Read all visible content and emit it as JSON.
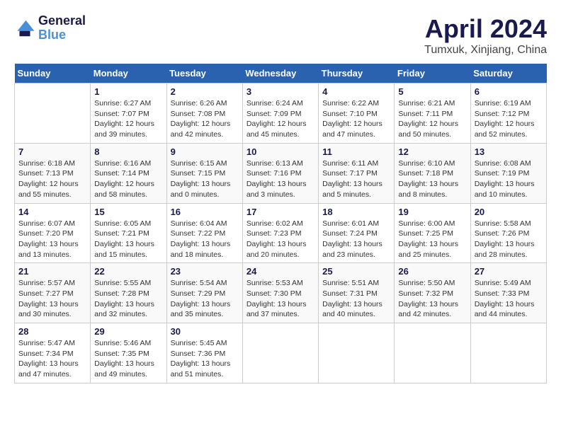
{
  "header": {
    "logo_line1": "General",
    "logo_line2": "Blue",
    "title": "April 2024",
    "subtitle": "Tumxuk, Xinjiang, China"
  },
  "weekdays": [
    "Sunday",
    "Monday",
    "Tuesday",
    "Wednesday",
    "Thursday",
    "Friday",
    "Saturday"
  ],
  "weeks": [
    [
      {
        "day": "",
        "sunrise": "",
        "sunset": "",
        "daylight": ""
      },
      {
        "day": "1",
        "sunrise": "Sunrise: 6:27 AM",
        "sunset": "Sunset: 7:07 PM",
        "daylight": "Daylight: 12 hours and 39 minutes."
      },
      {
        "day": "2",
        "sunrise": "Sunrise: 6:26 AM",
        "sunset": "Sunset: 7:08 PM",
        "daylight": "Daylight: 12 hours and 42 minutes."
      },
      {
        "day": "3",
        "sunrise": "Sunrise: 6:24 AM",
        "sunset": "Sunset: 7:09 PM",
        "daylight": "Daylight: 12 hours and 45 minutes."
      },
      {
        "day": "4",
        "sunrise": "Sunrise: 6:22 AM",
        "sunset": "Sunset: 7:10 PM",
        "daylight": "Daylight: 12 hours and 47 minutes."
      },
      {
        "day": "5",
        "sunrise": "Sunrise: 6:21 AM",
        "sunset": "Sunset: 7:11 PM",
        "daylight": "Daylight: 12 hours and 50 minutes."
      },
      {
        "day": "6",
        "sunrise": "Sunrise: 6:19 AM",
        "sunset": "Sunset: 7:12 PM",
        "daylight": "Daylight: 12 hours and 52 minutes."
      }
    ],
    [
      {
        "day": "7",
        "sunrise": "Sunrise: 6:18 AM",
        "sunset": "Sunset: 7:13 PM",
        "daylight": "Daylight: 12 hours and 55 minutes."
      },
      {
        "day": "8",
        "sunrise": "Sunrise: 6:16 AM",
        "sunset": "Sunset: 7:14 PM",
        "daylight": "Daylight: 12 hours and 58 minutes."
      },
      {
        "day": "9",
        "sunrise": "Sunrise: 6:15 AM",
        "sunset": "Sunset: 7:15 PM",
        "daylight": "Daylight: 13 hours and 0 minutes."
      },
      {
        "day": "10",
        "sunrise": "Sunrise: 6:13 AM",
        "sunset": "Sunset: 7:16 PM",
        "daylight": "Daylight: 13 hours and 3 minutes."
      },
      {
        "day": "11",
        "sunrise": "Sunrise: 6:11 AM",
        "sunset": "Sunset: 7:17 PM",
        "daylight": "Daylight: 13 hours and 5 minutes."
      },
      {
        "day": "12",
        "sunrise": "Sunrise: 6:10 AM",
        "sunset": "Sunset: 7:18 PM",
        "daylight": "Daylight: 13 hours and 8 minutes."
      },
      {
        "day": "13",
        "sunrise": "Sunrise: 6:08 AM",
        "sunset": "Sunset: 7:19 PM",
        "daylight": "Daylight: 13 hours and 10 minutes."
      }
    ],
    [
      {
        "day": "14",
        "sunrise": "Sunrise: 6:07 AM",
        "sunset": "Sunset: 7:20 PM",
        "daylight": "Daylight: 13 hours and 13 minutes."
      },
      {
        "day": "15",
        "sunrise": "Sunrise: 6:05 AM",
        "sunset": "Sunset: 7:21 PM",
        "daylight": "Daylight: 13 hours and 15 minutes."
      },
      {
        "day": "16",
        "sunrise": "Sunrise: 6:04 AM",
        "sunset": "Sunset: 7:22 PM",
        "daylight": "Daylight: 13 hours and 18 minutes."
      },
      {
        "day": "17",
        "sunrise": "Sunrise: 6:02 AM",
        "sunset": "Sunset: 7:23 PM",
        "daylight": "Daylight: 13 hours and 20 minutes."
      },
      {
        "day": "18",
        "sunrise": "Sunrise: 6:01 AM",
        "sunset": "Sunset: 7:24 PM",
        "daylight": "Daylight: 13 hours and 23 minutes."
      },
      {
        "day": "19",
        "sunrise": "Sunrise: 6:00 AM",
        "sunset": "Sunset: 7:25 PM",
        "daylight": "Daylight: 13 hours and 25 minutes."
      },
      {
        "day": "20",
        "sunrise": "Sunrise: 5:58 AM",
        "sunset": "Sunset: 7:26 PM",
        "daylight": "Daylight: 13 hours and 28 minutes."
      }
    ],
    [
      {
        "day": "21",
        "sunrise": "Sunrise: 5:57 AM",
        "sunset": "Sunset: 7:27 PM",
        "daylight": "Daylight: 13 hours and 30 minutes."
      },
      {
        "day": "22",
        "sunrise": "Sunrise: 5:55 AM",
        "sunset": "Sunset: 7:28 PM",
        "daylight": "Daylight: 13 hours and 32 minutes."
      },
      {
        "day": "23",
        "sunrise": "Sunrise: 5:54 AM",
        "sunset": "Sunset: 7:29 PM",
        "daylight": "Daylight: 13 hours and 35 minutes."
      },
      {
        "day": "24",
        "sunrise": "Sunrise: 5:53 AM",
        "sunset": "Sunset: 7:30 PM",
        "daylight": "Daylight: 13 hours and 37 minutes."
      },
      {
        "day": "25",
        "sunrise": "Sunrise: 5:51 AM",
        "sunset": "Sunset: 7:31 PM",
        "daylight": "Daylight: 13 hours and 40 minutes."
      },
      {
        "day": "26",
        "sunrise": "Sunrise: 5:50 AM",
        "sunset": "Sunset: 7:32 PM",
        "daylight": "Daylight: 13 hours and 42 minutes."
      },
      {
        "day": "27",
        "sunrise": "Sunrise: 5:49 AM",
        "sunset": "Sunset: 7:33 PM",
        "daylight": "Daylight: 13 hours and 44 minutes."
      }
    ],
    [
      {
        "day": "28",
        "sunrise": "Sunrise: 5:47 AM",
        "sunset": "Sunset: 7:34 PM",
        "daylight": "Daylight: 13 hours and 47 minutes."
      },
      {
        "day": "29",
        "sunrise": "Sunrise: 5:46 AM",
        "sunset": "Sunset: 7:35 PM",
        "daylight": "Daylight: 13 hours and 49 minutes."
      },
      {
        "day": "30",
        "sunrise": "Sunrise: 5:45 AM",
        "sunset": "Sunset: 7:36 PM",
        "daylight": "Daylight: 13 hours and 51 minutes."
      },
      {
        "day": "",
        "sunrise": "",
        "sunset": "",
        "daylight": ""
      },
      {
        "day": "",
        "sunrise": "",
        "sunset": "",
        "daylight": ""
      },
      {
        "day": "",
        "sunrise": "",
        "sunset": "",
        "daylight": ""
      },
      {
        "day": "",
        "sunrise": "",
        "sunset": "",
        "daylight": ""
      }
    ]
  ]
}
